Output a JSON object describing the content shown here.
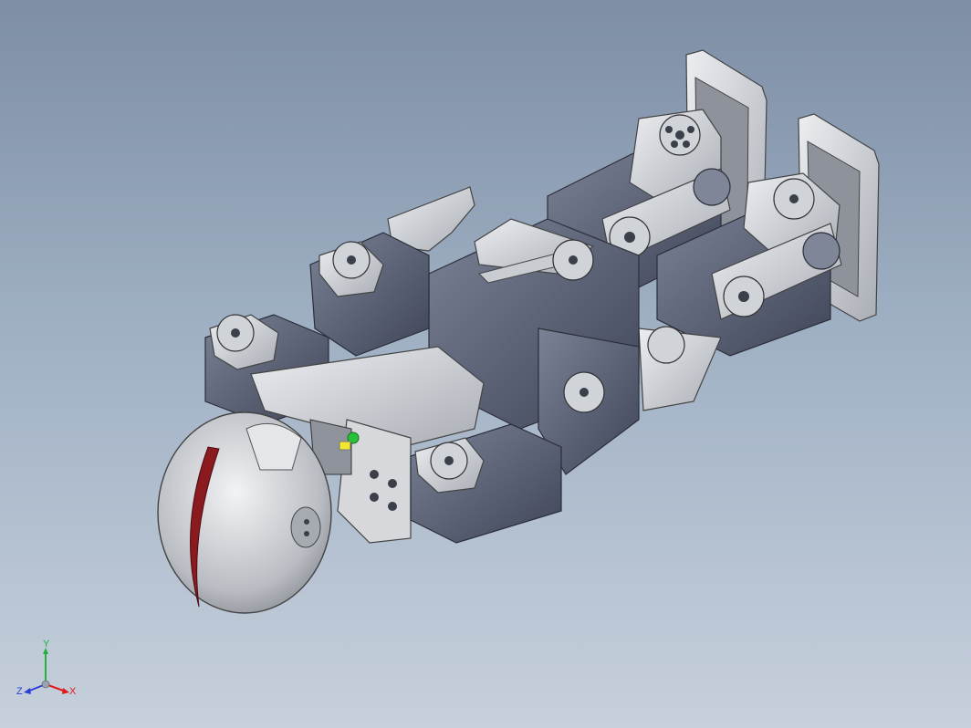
{
  "viewport": {
    "triad": {
      "x_label": "X",
      "y_label": "Y",
      "z_label": "Z",
      "x_color": "#e01b1b",
      "y_color": "#22b33c",
      "z_color": "#2a3fd8"
    },
    "colors": {
      "background_top": "#7d8ea5",
      "background_bottom": "#c7d0dc",
      "servo_dark": "#4a5163",
      "servo_mid": "#6b7387",
      "bracket_light": "#d6d8dc",
      "bracket_mid": "#b7babf",
      "accent_red": "#8b1a1f"
    }
  }
}
